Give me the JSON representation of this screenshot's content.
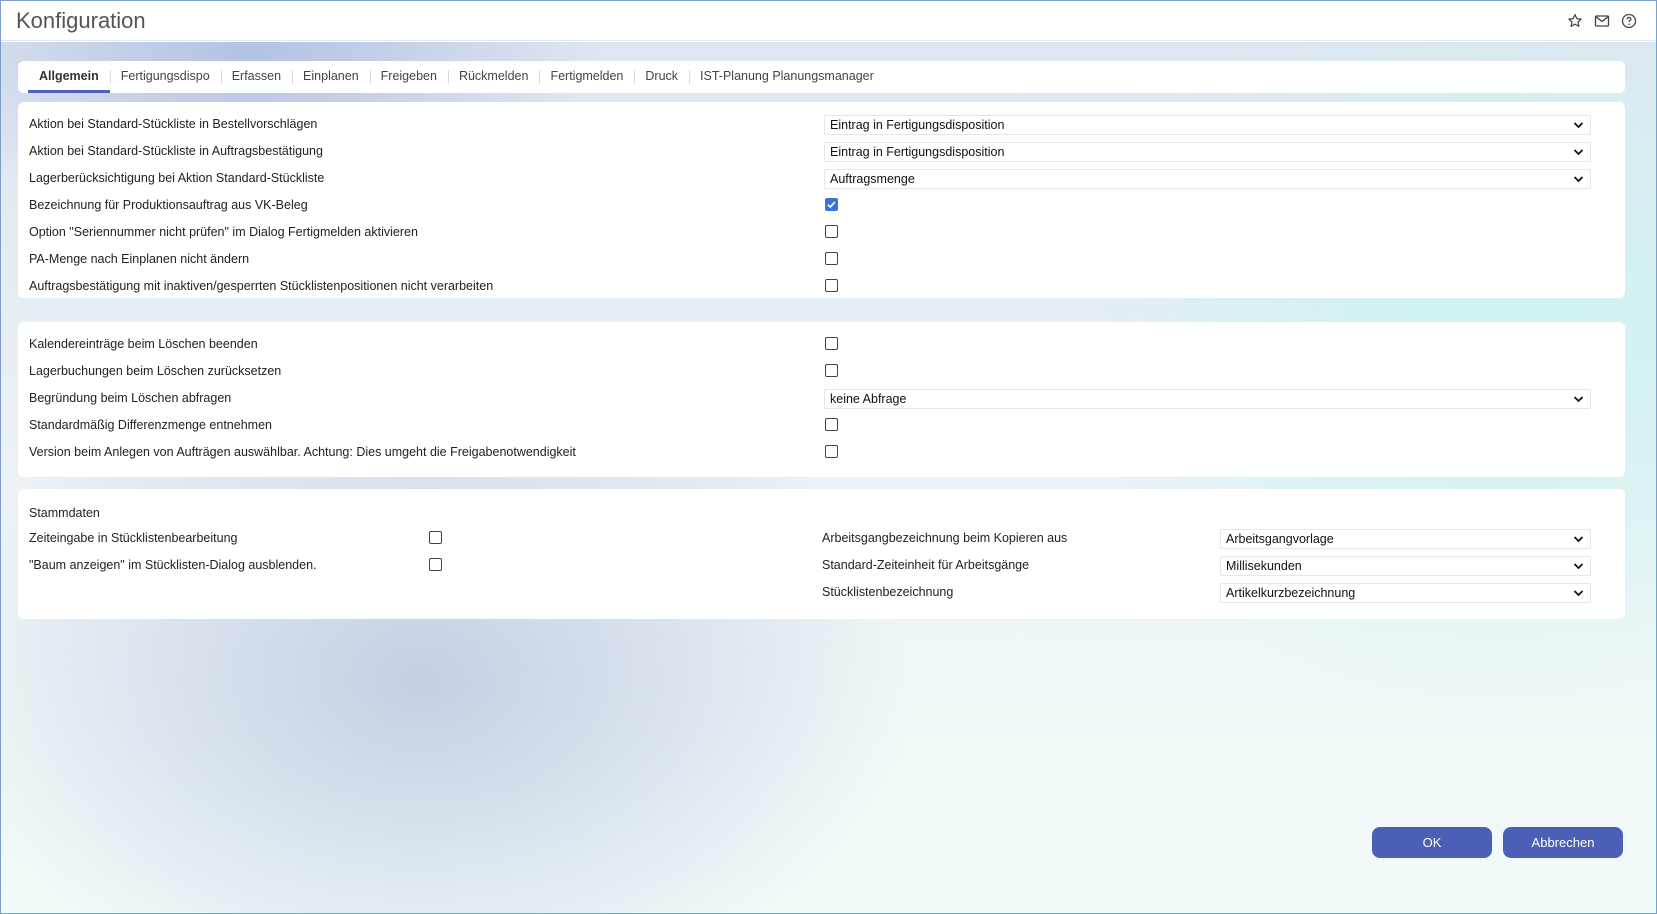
{
  "window": {
    "title": "Konfiguration"
  },
  "toolbar": {
    "icons": [
      "star-icon",
      "mail-icon",
      "help-icon"
    ]
  },
  "tabs": [
    {
      "label": "Allgemein",
      "active": true
    },
    {
      "label": "Fertigungsdispo",
      "active": false
    },
    {
      "label": "Erfassen",
      "active": false
    },
    {
      "label": "Einplanen",
      "active": false
    },
    {
      "label": "Freigeben",
      "active": false
    },
    {
      "label": "Rückmelden",
      "active": false
    },
    {
      "label": "Fertigmelden",
      "active": false
    },
    {
      "label": "Druck",
      "active": false
    },
    {
      "label": "IST-Planung Planungsmanager",
      "active": false
    }
  ],
  "panel1": {
    "rows": [
      {
        "label": "Aktion bei Standard-Stückliste in Bestellvorschlägen",
        "value": "Eintrag in Fertigungsdisposition"
      },
      {
        "label": "Aktion bei Standard-Stückliste in Auftragsbestätigung",
        "value": "Eintrag in Fertigungsdisposition"
      },
      {
        "label": "Lagerberücksichtigung bei Aktion Standard-Stückliste",
        "value": "Auftragsmenge"
      },
      {
        "label": "Bezeichnung für Produktionsauftrag aus VK-Beleg",
        "checked": true
      },
      {
        "label": "Option \"Seriennummer nicht prüfen\" im Dialog Fertigmelden aktivieren",
        "checked": false
      },
      {
        "label": "PA-Menge nach Einplanen nicht ändern",
        "checked": false
      },
      {
        "label": "Auftragsbestätigung mit inaktiven/gesperrten Stücklistenpositionen nicht verarbeiten",
        "checked": false
      }
    ]
  },
  "panel2": {
    "rows": [
      {
        "label": "Kalendereinträge beim Löschen beenden",
        "checked": false
      },
      {
        "label": "Lagerbuchungen beim Löschen zurücksetzen",
        "checked": false
      },
      {
        "label": "Begründung beim Löschen abfragen",
        "value": "keine Abfrage"
      },
      {
        "label": "Standardmäßig Differenzmenge entnehmen",
        "checked": false
      },
      {
        "label": "Version beim Anlegen von Aufträgen auswählbar. Achtung: Dies umgeht die Freigabenotwendigkeit",
        "checked": false
      }
    ]
  },
  "panel3": {
    "title": "Stammdaten",
    "left": [
      {
        "label": "Zeiteingabe in Stücklistenbearbeitung",
        "checked": false
      },
      {
        "label": "\"Baum anzeigen\" im Stücklisten-Dialog ausblenden.",
        "checked": false
      }
    ],
    "right": [
      {
        "label": "Arbeitsgangbezeichnung beim Kopieren aus",
        "value": "Arbeitsgangvorlage"
      },
      {
        "label": "Standard-Zeiteinheit für Arbeitsgänge",
        "value": "Millisekunden"
      },
      {
        "label": "Stücklistenbezeichnung",
        "value": "Artikelkurzbezeichnung"
      }
    ]
  },
  "buttons": {
    "ok": "OK",
    "cancel": "Abbrechen"
  }
}
